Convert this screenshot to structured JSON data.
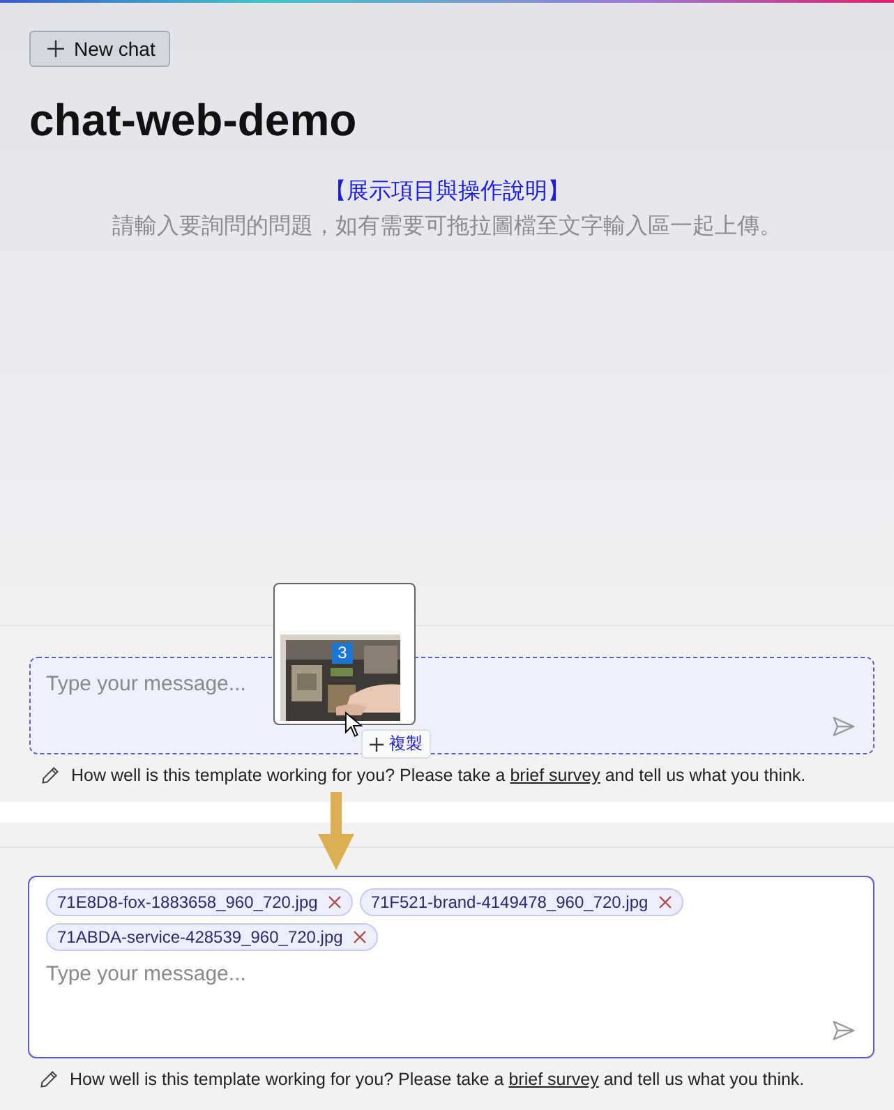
{
  "top_panel": {
    "new_chat_button": {
      "label": "New chat"
    },
    "title": "chat-web-demo",
    "intro_link": "【展示項目與操作說明】",
    "intro_text": "請輸入要詢問的問題，如有需要可拖拉圖檔至文字輸入區一起上傳。",
    "composer": {
      "placeholder": "Type your message...",
      "drag_over": true
    },
    "drag_preview": {
      "count": "3",
      "drop_hint": "複製"
    },
    "footer": {
      "text_before": "How well is this template working for you? Please take a",
      "link": "brief survey",
      "text_after": "and tell us what you think."
    }
  },
  "bottom_panel": {
    "composer": {
      "drag_over": false,
      "attachments": [
        {
          "name": "71E8D8-fox-1883658_960_720.jpg"
        },
        {
          "name": "71F521-brand-4149478_960_720.jpg"
        },
        {
          "name": "71ABDA-service-428539_960_720.jpg"
        }
      ],
      "placeholder": "Type your message..."
    },
    "footer": {
      "text_before": "How well is this template working for you? Please take a",
      "link": "brief survey",
      "text_after": "and tell us what you think."
    }
  }
}
